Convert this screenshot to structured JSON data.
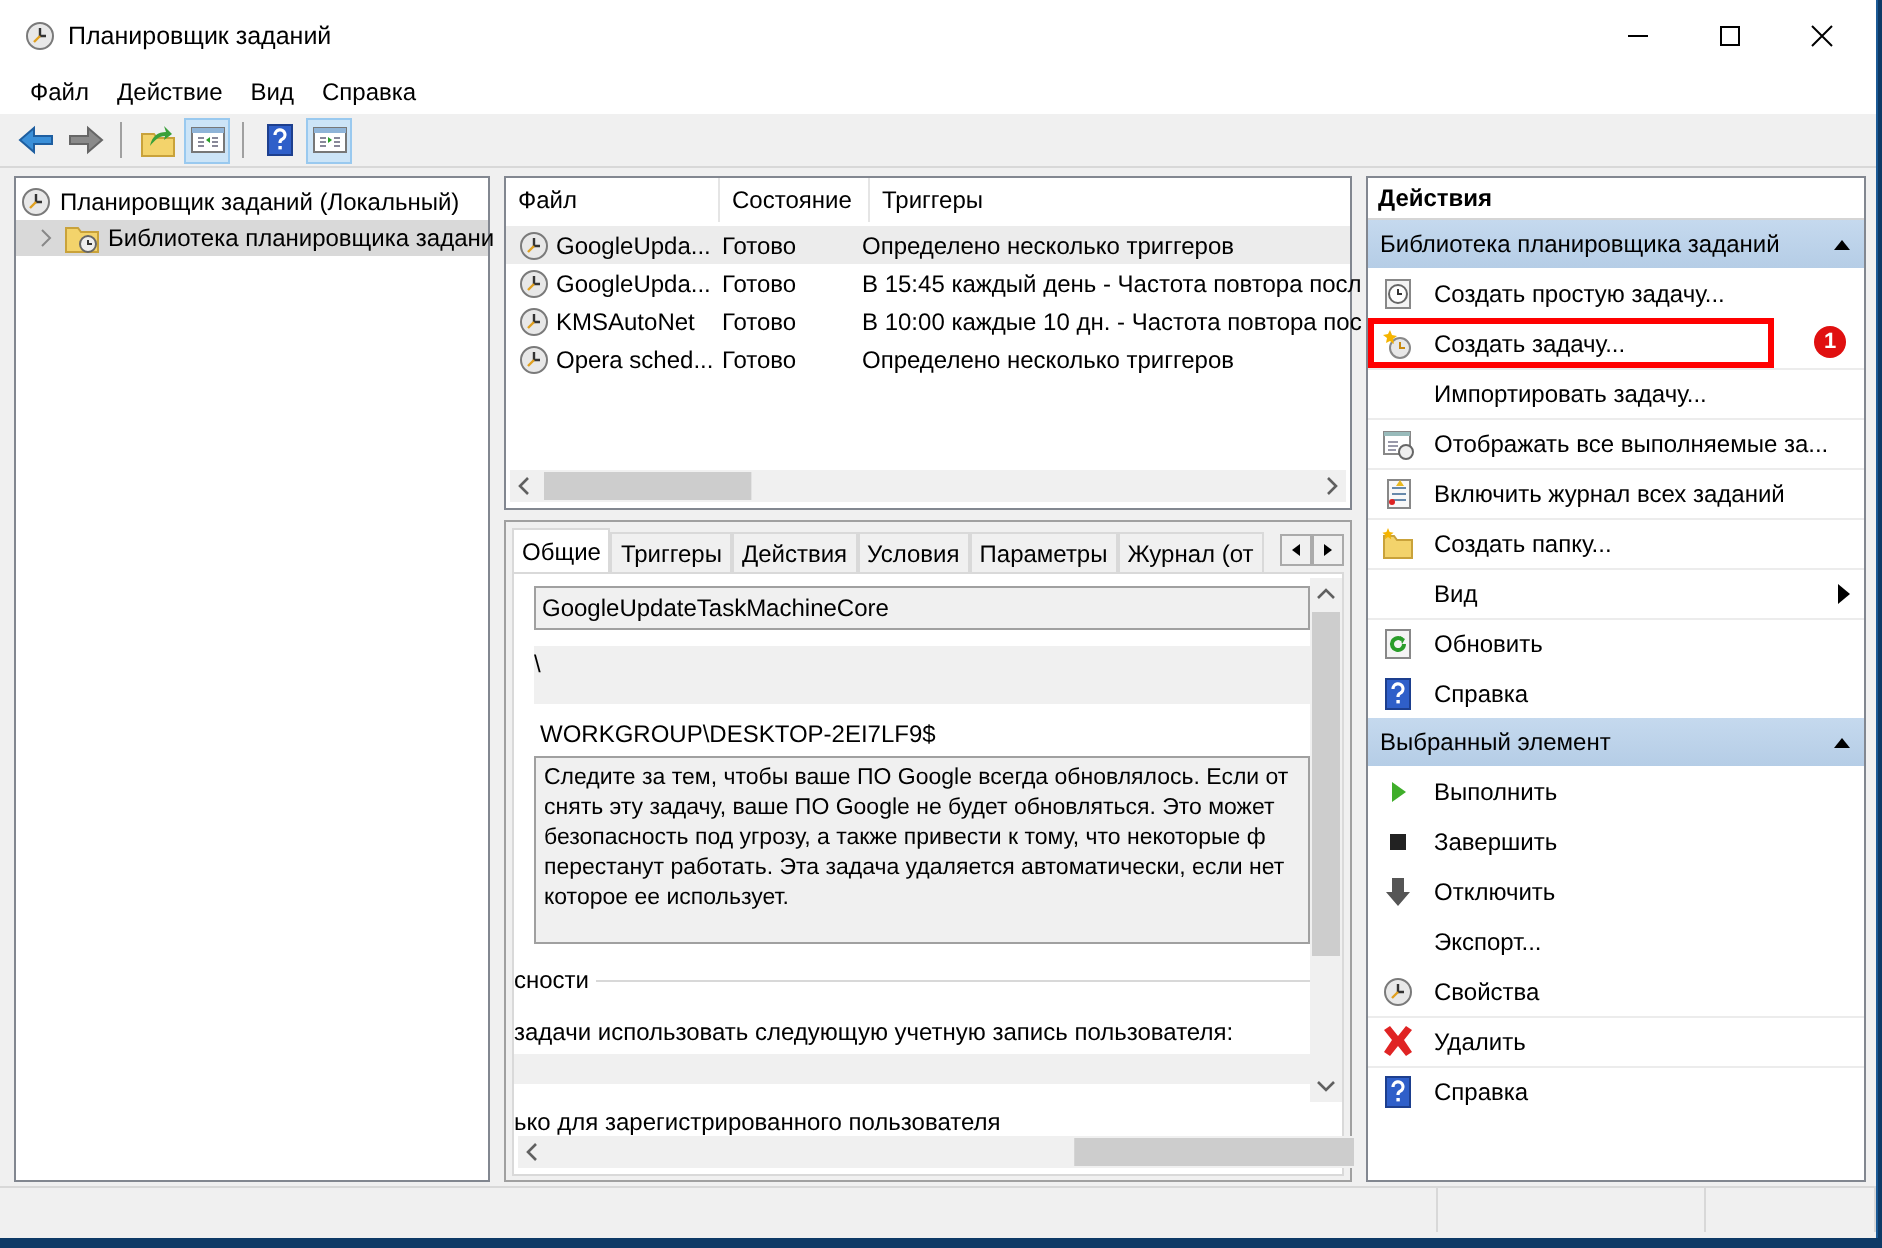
{
  "window": {
    "title": "Планировщик заданий"
  },
  "menu": [
    "Файл",
    "Действие",
    "Вид",
    "Справка"
  ],
  "toolbar": [
    {
      "kind": "back",
      "on": false
    },
    {
      "kind": "forward",
      "on": false
    },
    {
      "kind": "separator"
    },
    {
      "kind": "up-folder",
      "on": false
    },
    {
      "kind": "pane-left",
      "on": true
    },
    {
      "kind": "separator"
    },
    {
      "kind": "help",
      "on": false
    },
    {
      "kind": "pane-right",
      "on": true
    }
  ],
  "tree": [
    {
      "label": "Планировщик заданий (Локальный)",
      "kind": "clock",
      "expanded": true,
      "selected": false,
      "children": [
        {
          "label": "Библиотека планировщика задани",
          "kind": "folder-clock",
          "expanded": false,
          "selected": true
        }
      ]
    }
  ],
  "table": {
    "columns": [
      "Файл",
      "Состояние",
      "Триггеры"
    ],
    "rows": [
      {
        "cells": [
          "GoogleUpda...",
          "Готово",
          "Определено несколько триггеров"
        ],
        "selected": true
      },
      {
        "cells": [
          "GoogleUpda...",
          "Готово",
          "В 15:45 каждый день - Частота повтора посл"
        ],
        "selected": false
      },
      {
        "cells": [
          "KMSAutoNet",
          "Готово",
          "В 10:00 каждые 10 дн. - Частота повтора пос"
        ],
        "selected": false
      },
      {
        "cells": [
          "Opera sched...",
          "Готово",
          "Определено несколько триггеров"
        ],
        "selected": false
      }
    ]
  },
  "tabs": [
    {
      "label": "Общие",
      "selected": true
    },
    {
      "label": "Триггеры",
      "selected": false
    },
    {
      "label": "Действия",
      "selected": false
    },
    {
      "label": "Условия",
      "selected": false
    },
    {
      "label": "Параметры",
      "selected": false
    },
    {
      "label": "Журнал (от",
      "selected": false
    }
  ],
  "general": {
    "name": "GoogleUpdateTaskMachineCore",
    "location": "\\",
    "author": "WORKGROUP\\DESKTOP-2EI7LF9$",
    "description": [
      "Следите за тем, чтобы ваше ПО Google всегда обновлялось. Если от",
      "снять эту задачу, ваше ПО Google не будет обновляться. Это может",
      "безопасность под угрозу, а также привести к тому, что некоторые ф",
      "перестанут работать. Эта задача удаляется автоматически, если нет",
      "которое ее использует."
    ],
    "security_heading": "сности",
    "account_label": "задачи использовать следующую учетную запись пользователя:",
    "logon_option": "ько для зарегистрированного пользователя"
  },
  "actions": {
    "title": "Действия",
    "sections": [
      {
        "title": "Библиотека планировщика заданий",
        "expanded": true,
        "items": [
          {
            "label": "Создать простую задачу...",
            "kind": "clock-doc",
            "divider": false,
            "highlighted": false
          },
          {
            "label": "Создать задачу...",
            "kind": "clock-star",
            "divider": true,
            "highlighted": true,
            "callout": "1"
          },
          {
            "label": "Импортировать задачу...",
            "kind": "none",
            "divider": true,
            "highlighted": false
          },
          {
            "label": "Отображать все выполняемые за...",
            "kind": "list-clock",
            "divider": true,
            "highlighted": false
          },
          {
            "label": "Включить журнал всех заданий",
            "kind": "log",
            "divider": true,
            "highlighted": false
          },
          {
            "label": "Создать папку...",
            "kind": "folder-new",
            "divider": true,
            "highlighted": false
          },
          {
            "label": "Вид",
            "kind": "none",
            "divider": true,
            "highlighted": false,
            "submenu": true
          },
          {
            "label": "Обновить",
            "kind": "refresh",
            "divider": true,
            "highlighted": false
          },
          {
            "label": "Справка",
            "kind": "help",
            "divider": false,
            "highlighted": false
          }
        ]
      },
      {
        "title": "Выбранный элемент",
        "expanded": true,
        "items": [
          {
            "label": "Выполнить",
            "kind": "play",
            "divider": false,
            "highlighted": false
          },
          {
            "label": "Завершить",
            "kind": "stop",
            "divider": false,
            "highlighted": false
          },
          {
            "label": "Отключить",
            "kind": "down-arrow",
            "divider": false,
            "highlighted": false
          },
          {
            "label": "Экспорт...",
            "kind": "none",
            "divider": false,
            "highlighted": false
          },
          {
            "label": "Свойства",
            "kind": "clock",
            "divider": false,
            "highlighted": false
          },
          {
            "label": "Удалить",
            "kind": "delete",
            "divider": true,
            "highlighted": false
          },
          {
            "label": "Справка",
            "kind": "help",
            "divider": true,
            "highlighted": false
          }
        ]
      }
    ]
  }
}
